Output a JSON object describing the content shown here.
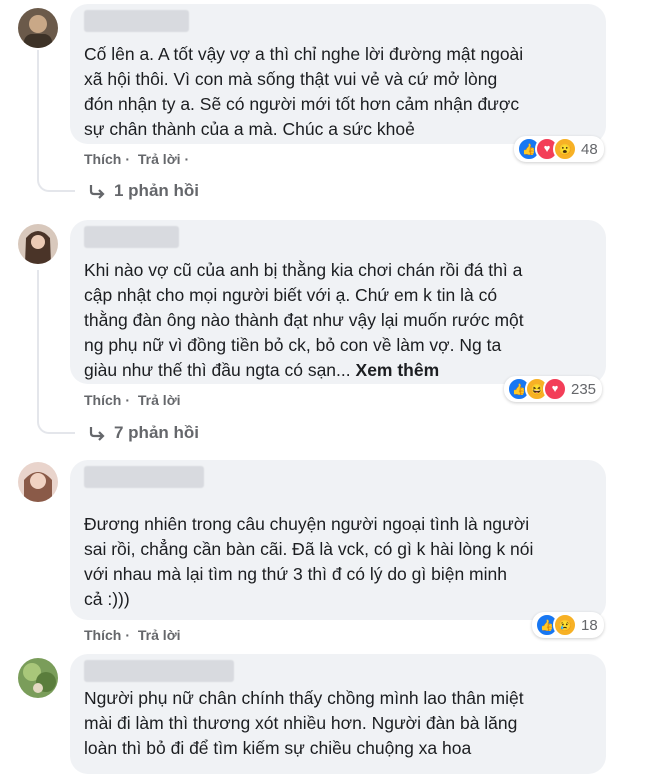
{
  "comments": [
    {
      "text": "Cố lên a. A tốt vậy vợ a thì chỉ nghe lời đường mật ngoài\nxã hội thôi. Vì con mà sống thật vui vẻ và cứ mở lòng\nđón nhận ty a. Sẽ có người mới tốt hơn cảm nhận được\nsự chân thành của a mà. Chúc a sức khoẻ",
      "like_label": "Thích",
      "reply_label": "Trả lời",
      "reaction_count": "48",
      "reaction_icons": [
        "like-icon",
        "love-icon",
        "wow-icon"
      ],
      "replies_label": "1 phản hồi"
    },
    {
      "text": "Khi nào vợ cũ của anh bị thằng kia chơi chán rồi đá thì a\ncập nhật cho mọi người biết với ạ. Chứ em k tin là có\nthằng đàn ông nào thành đạt như vậy lại muốn rước một\nng phụ nữ vì đồng tiền bỏ ck, bỏ con về làm vợ. Ng ta\ngiàu như thế thì đầu ngta có sạn...",
      "see_more": "Xem thêm",
      "like_label": "Thích",
      "reply_label": "Trả lời",
      "reaction_count": "235",
      "reaction_icons": [
        "like-icon",
        "haha-icon",
        "love-icon"
      ],
      "replies_label": "7 phản hồi"
    },
    {
      "text": "Đương nhiên trong câu chuyện người ngoại tình là người\nsai rồi, chẳng cần bàn cãi. Đã là vck, có gì k hài lòng k nói\nvới nhau mà lại tìm ng thứ 3 thì đ có lý do gì biện minh\ncả :)))",
      "like_label": "Thích",
      "reply_label": "Trả lời",
      "reaction_count": "18",
      "reaction_icons": [
        "like-icon",
        "sad-icon"
      ]
    },
    {
      "text": "Người phụ nữ chân chính thấy chồng mình lao thân miệt\nmài đi làm thì thương xót nhiều hơn. Người đàn bà lăng\nloàn thì bỏ đi để tìm kiếm sự chiều chuộng xa hoa"
    }
  ],
  "separator": "·",
  "reply_arrow_icon": "reply-arrow-icon"
}
